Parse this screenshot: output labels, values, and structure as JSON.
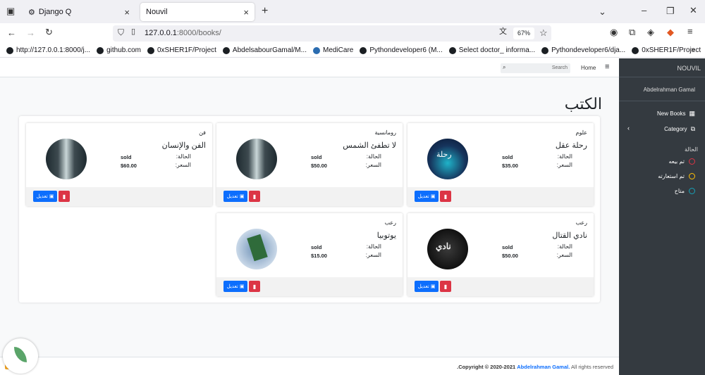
{
  "browser": {
    "tabs": [
      {
        "label": "Django Q"
      },
      {
        "label": "Nouvil"
      }
    ],
    "new_tab": "+",
    "url_prefix": "127.0.0.1",
    "url_suffix": ":8000/books/",
    "zoom": "67%",
    "bookmarks": [
      "http://127.0.0.1:8000/j...",
      "github.com",
      "0xSHER1F/Project",
      "AbdelsabourGamal/M...",
      "MediCare",
      "Pythondeveloper6 (M...",
      "Select doctor_ informa...",
      "Pythondeveloper6/dja...",
      "0xSHER1F/Project"
    ]
  },
  "topnav": {
    "search_placeholder": "Search",
    "home": "Home"
  },
  "page_title": "الكتب",
  "books": [
    {
      "category": "علوم",
      "title": "رحلة عقل",
      "status_label": "الحالة:",
      "status": "sold",
      "price_label": "السعر:",
      "price": "$35.00",
      "edit": "تعديل"
    },
    {
      "category": "رومانسية",
      "title": "لا تطفئ الشمس",
      "status_label": "الحالة:",
      "status": "sold",
      "price_label": "السعر:",
      "price": "$50.00",
      "edit": "تعديل"
    },
    {
      "category": "فن",
      "title": "الفن والإنسان",
      "status_label": "الحالة:",
      "status": "sold",
      "price_label": "السعر:",
      "price": "$60.00",
      "edit": "تعديل"
    },
    {
      "category": "رعب",
      "title": "نادي القتال",
      "status_label": "الحالة:",
      "status": "sold",
      "price_label": "السعر:",
      "price": "$50.00",
      "edit": "تعديل"
    },
    {
      "category": "رعب",
      "title": "يوتوبيا",
      "status_label": "الحالة:",
      "status": "sold",
      "price_label": "السعر:",
      "price": "$15.00",
      "edit": "تعديل"
    }
  ],
  "sidebar": {
    "brand": "NOUVIL",
    "user": "Abdelrahman Gamal",
    "new_books": "New Books",
    "category": "Category",
    "status_heading": "الحالة",
    "statuses": [
      {
        "label": "تم بيعه",
        "color": "#dc3545"
      },
      {
        "label": "تم استعارته",
        "color": "#ffc107"
      },
      {
        "label": "متاح",
        "color": "#17a2b8"
      }
    ]
  },
  "footer": {
    "copyright_prefix": "Copyright © 2020-2021",
    "author": "Abdelrahman Gamal.",
    "suffix": "All rights reserved",
    "dot": "."
  }
}
